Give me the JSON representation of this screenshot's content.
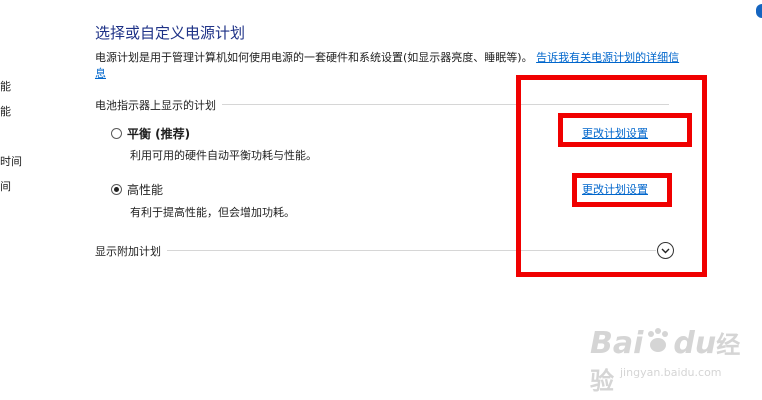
{
  "sidebar": {
    "items": [
      {
        "label": "能"
      },
      {
        "label": "能"
      },
      {
        "label": "时间"
      },
      {
        "label": "间"
      }
    ]
  },
  "page": {
    "title": "选择或自定义电源计划",
    "description": "电源计划是用于管理计算机如何使用电源的一套硬件和系统设置(如显示器亮度、睡眠等)。",
    "description_link": "告诉我有关电源计划的详细信息"
  },
  "battery_section": {
    "label": "电池指示器上显示的计划",
    "plans": [
      {
        "name": "平衡 (推荐)",
        "description": "利用可用的硬件自动平衡功耗与性能。",
        "change_link": "更改计划设置",
        "selected": false
      },
      {
        "name": "高性能",
        "description": "有利于提高性能，但会增加功耗。",
        "change_link": "更改计划设置",
        "selected": true
      }
    ]
  },
  "additional": {
    "label": "显示附加计划"
  },
  "icons": {
    "expand": "chevron-down-icon",
    "radio": "radio-icon"
  },
  "watermark": {
    "brand": "Bai",
    "brand2": "du",
    "suffix": "经验",
    "url": "jingyan.baidu.com"
  },
  "colors": {
    "title": "#1e3287",
    "link": "#0066cc",
    "highlight": "#f00000"
  }
}
